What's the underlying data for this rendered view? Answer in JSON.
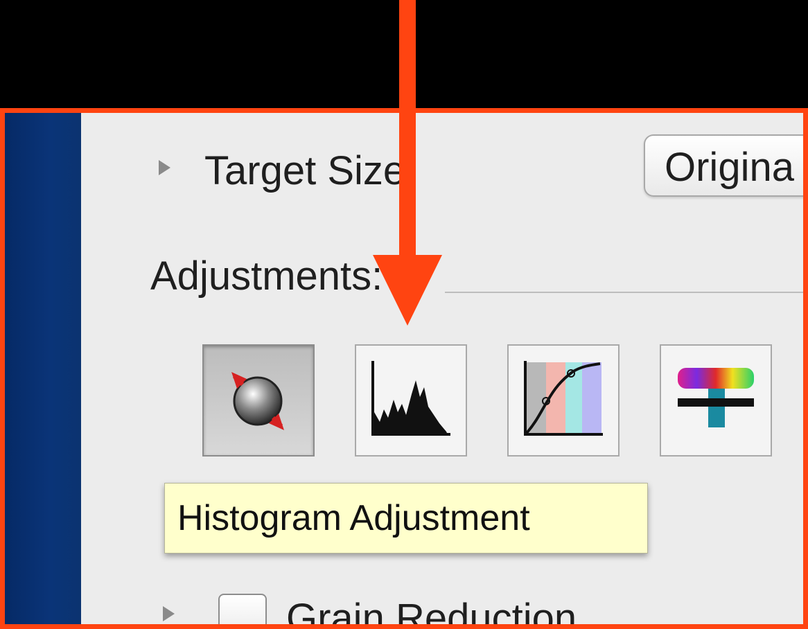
{
  "target_size": {
    "label": "Target Size:",
    "value": "Origina"
  },
  "adjustments": {
    "heading": "Adjustments:",
    "tools": [
      {
        "icon": "color-balance-icon",
        "selected": true
      },
      {
        "icon": "histogram-icon",
        "selected": false
      },
      {
        "icon": "curves-icon",
        "selected": false
      },
      {
        "icon": "color-range-icon",
        "selected": false
      }
    ],
    "tooltip": "Histogram Adjustment"
  },
  "grain_reduction": {
    "label": "Grain Reduction",
    "checked": false
  },
  "colors": {
    "highlight": "#ff4411",
    "tooltip_bg": "#ffffcc",
    "sidebar": "#0a3478",
    "panel": "#ececec"
  }
}
